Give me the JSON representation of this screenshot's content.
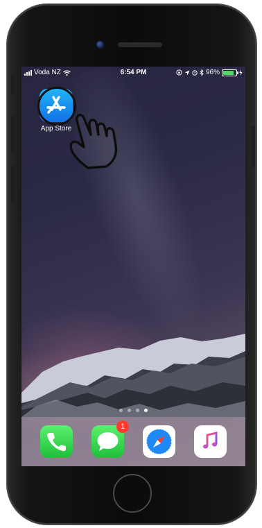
{
  "status_bar": {
    "carrier": "Voda NZ",
    "time": "6:54 PM",
    "battery_percent": "96%",
    "battery_level": 0.96,
    "icons": [
      "signal-icon",
      "wifi-icon",
      "lock-rotation-icon",
      "location-icon",
      "alarm-icon",
      "bluetooth-icon",
      "battery-icon",
      "charging-icon"
    ]
  },
  "home_screen": {
    "apps": [
      {
        "label": "App Store",
        "icon": "app-store-icon"
      }
    ],
    "page_dots": 4,
    "current_page": 4,
    "gesture": "tap-hand-icon"
  },
  "dock": {
    "apps": [
      {
        "name": "Phone",
        "icon": "phone-icon"
      },
      {
        "name": "Messages",
        "icon": "messages-icon",
        "badge": "1"
      },
      {
        "name": "Safari",
        "icon": "safari-icon"
      },
      {
        "name": "Music",
        "icon": "music-icon"
      }
    ]
  },
  "colors": {
    "app_store_top": "#1fb4f5",
    "app_store_bottom": "#1471e6",
    "green_app": "#1fbf3a",
    "badge": "#ff3b30",
    "battery_fill": "#4cd964"
  }
}
